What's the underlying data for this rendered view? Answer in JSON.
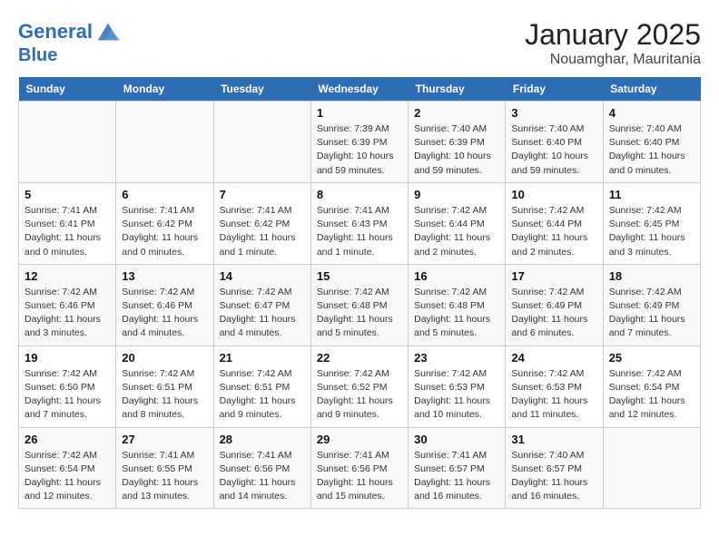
{
  "logo": {
    "line1": "General",
    "line2": "Blue"
  },
  "title": "January 2025",
  "subtitle": "Nouamghar, Mauritania",
  "weekdays": [
    "Sunday",
    "Monday",
    "Tuesday",
    "Wednesday",
    "Thursday",
    "Friday",
    "Saturday"
  ],
  "weeks": [
    [
      {
        "day": "",
        "info": ""
      },
      {
        "day": "",
        "info": ""
      },
      {
        "day": "",
        "info": ""
      },
      {
        "day": "1",
        "info": "Sunrise: 7:39 AM\nSunset: 6:39 PM\nDaylight: 10 hours and 59 minutes."
      },
      {
        "day": "2",
        "info": "Sunrise: 7:40 AM\nSunset: 6:39 PM\nDaylight: 10 hours and 59 minutes."
      },
      {
        "day": "3",
        "info": "Sunrise: 7:40 AM\nSunset: 6:40 PM\nDaylight: 10 hours and 59 minutes."
      },
      {
        "day": "4",
        "info": "Sunrise: 7:40 AM\nSunset: 6:40 PM\nDaylight: 11 hours and 0 minutes."
      }
    ],
    [
      {
        "day": "5",
        "info": "Sunrise: 7:41 AM\nSunset: 6:41 PM\nDaylight: 11 hours and 0 minutes."
      },
      {
        "day": "6",
        "info": "Sunrise: 7:41 AM\nSunset: 6:42 PM\nDaylight: 11 hours and 0 minutes."
      },
      {
        "day": "7",
        "info": "Sunrise: 7:41 AM\nSunset: 6:42 PM\nDaylight: 11 hours and 1 minute."
      },
      {
        "day": "8",
        "info": "Sunrise: 7:41 AM\nSunset: 6:43 PM\nDaylight: 11 hours and 1 minute."
      },
      {
        "day": "9",
        "info": "Sunrise: 7:42 AM\nSunset: 6:44 PM\nDaylight: 11 hours and 2 minutes."
      },
      {
        "day": "10",
        "info": "Sunrise: 7:42 AM\nSunset: 6:44 PM\nDaylight: 11 hours and 2 minutes."
      },
      {
        "day": "11",
        "info": "Sunrise: 7:42 AM\nSunset: 6:45 PM\nDaylight: 11 hours and 3 minutes."
      }
    ],
    [
      {
        "day": "12",
        "info": "Sunrise: 7:42 AM\nSunset: 6:46 PM\nDaylight: 11 hours and 3 minutes."
      },
      {
        "day": "13",
        "info": "Sunrise: 7:42 AM\nSunset: 6:46 PM\nDaylight: 11 hours and 4 minutes."
      },
      {
        "day": "14",
        "info": "Sunrise: 7:42 AM\nSunset: 6:47 PM\nDaylight: 11 hours and 4 minutes."
      },
      {
        "day": "15",
        "info": "Sunrise: 7:42 AM\nSunset: 6:48 PM\nDaylight: 11 hours and 5 minutes."
      },
      {
        "day": "16",
        "info": "Sunrise: 7:42 AM\nSunset: 6:48 PM\nDaylight: 11 hours and 5 minutes."
      },
      {
        "day": "17",
        "info": "Sunrise: 7:42 AM\nSunset: 6:49 PM\nDaylight: 11 hours and 6 minutes."
      },
      {
        "day": "18",
        "info": "Sunrise: 7:42 AM\nSunset: 6:49 PM\nDaylight: 11 hours and 7 minutes."
      }
    ],
    [
      {
        "day": "19",
        "info": "Sunrise: 7:42 AM\nSunset: 6:50 PM\nDaylight: 11 hours and 7 minutes."
      },
      {
        "day": "20",
        "info": "Sunrise: 7:42 AM\nSunset: 6:51 PM\nDaylight: 11 hours and 8 minutes."
      },
      {
        "day": "21",
        "info": "Sunrise: 7:42 AM\nSunset: 6:51 PM\nDaylight: 11 hours and 9 minutes."
      },
      {
        "day": "22",
        "info": "Sunrise: 7:42 AM\nSunset: 6:52 PM\nDaylight: 11 hours and 9 minutes."
      },
      {
        "day": "23",
        "info": "Sunrise: 7:42 AM\nSunset: 6:53 PM\nDaylight: 11 hours and 10 minutes."
      },
      {
        "day": "24",
        "info": "Sunrise: 7:42 AM\nSunset: 6:53 PM\nDaylight: 11 hours and 11 minutes."
      },
      {
        "day": "25",
        "info": "Sunrise: 7:42 AM\nSunset: 6:54 PM\nDaylight: 11 hours and 12 minutes."
      }
    ],
    [
      {
        "day": "26",
        "info": "Sunrise: 7:42 AM\nSunset: 6:54 PM\nDaylight: 11 hours and 12 minutes."
      },
      {
        "day": "27",
        "info": "Sunrise: 7:41 AM\nSunset: 6:55 PM\nDaylight: 11 hours and 13 minutes."
      },
      {
        "day": "28",
        "info": "Sunrise: 7:41 AM\nSunset: 6:56 PM\nDaylight: 11 hours and 14 minutes."
      },
      {
        "day": "29",
        "info": "Sunrise: 7:41 AM\nSunset: 6:56 PM\nDaylight: 11 hours and 15 minutes."
      },
      {
        "day": "30",
        "info": "Sunrise: 7:41 AM\nSunset: 6:57 PM\nDaylight: 11 hours and 16 minutes."
      },
      {
        "day": "31",
        "info": "Sunrise: 7:40 AM\nSunset: 6:57 PM\nDaylight: 11 hours and 16 minutes."
      },
      {
        "day": "",
        "info": ""
      }
    ]
  ]
}
